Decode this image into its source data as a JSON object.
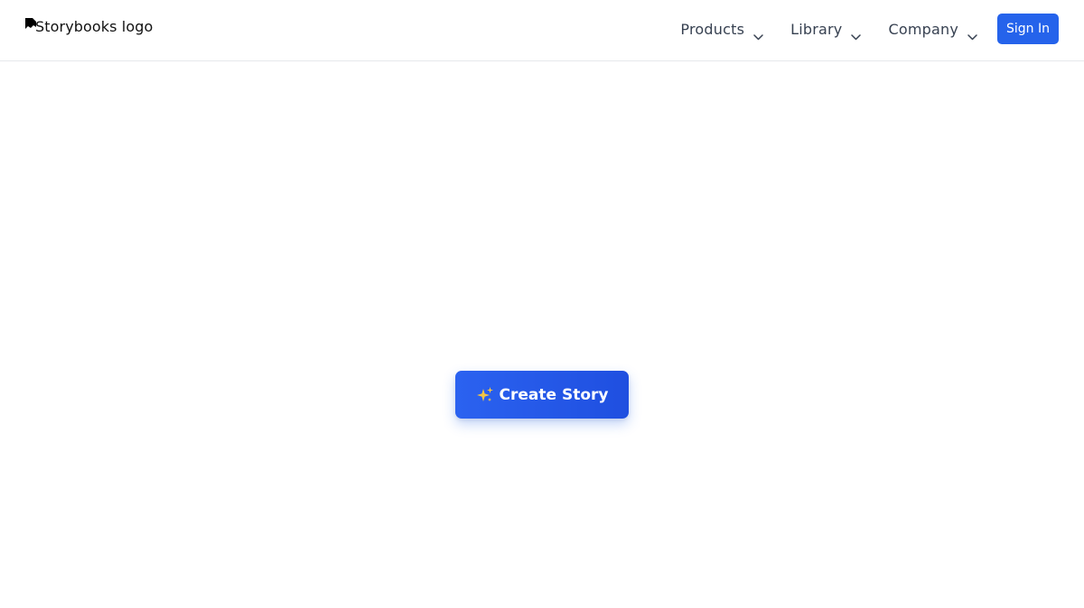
{
  "header": {
    "logo_alt": "Storybooks logo",
    "nav": [
      {
        "label": "Products",
        "icon": "chevron-down-icon"
      },
      {
        "label": "Library",
        "icon": "chevron-down-icon"
      },
      {
        "label": "Company",
        "icon": "chevron-down-icon"
      }
    ],
    "signin_label": "Sign In"
  },
  "main": {
    "create_label": "Create Story",
    "create_icon": "sparkles-icon"
  },
  "colors": {
    "accent": "#2563eb",
    "nav_text": "#374151",
    "sparkle": "#f5c542"
  }
}
